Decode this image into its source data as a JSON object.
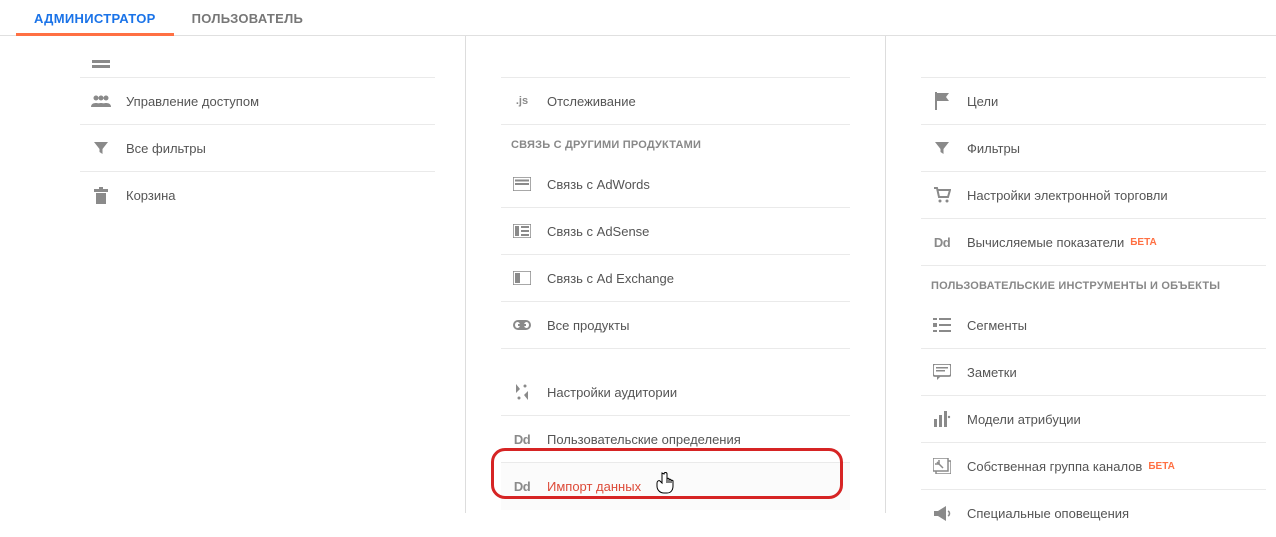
{
  "tabs": {
    "admin": "АДМИНИСТРАТОР",
    "user": "ПОЛЬЗОВАТЕЛЬ"
  },
  "col1": {
    "items": [
      {
        "label": "Управление доступом"
      },
      {
        "label": "Все фильтры"
      },
      {
        "label": "Корзина"
      }
    ]
  },
  "col2": {
    "tracking": {
      "label": "Отслеживание"
    },
    "header_products": "СВЯЗЬ С ДРУГИМИ ПРОДУКТАМИ",
    "products": [
      {
        "label": "Связь с AdWords"
      },
      {
        "label": "Связь с AdSense"
      },
      {
        "label": "Связь с Ad Exchange"
      },
      {
        "label": "Все продукты"
      }
    ],
    "audience": {
      "label": "Настройки аудитории"
    },
    "custom_def": {
      "label": "Пользовательские определения"
    },
    "import": {
      "label": "Импорт данных"
    }
  },
  "col3": {
    "goals": {
      "label": "Цели"
    },
    "filters": {
      "label": "Фильтры"
    },
    "ecom": {
      "label": "Настройки электронной торговли"
    },
    "calc": {
      "label": "Вычисляемые показатели",
      "badge": "БЕТА"
    },
    "header_tools": "ПОЛЬЗОВАТЕЛЬСКИЕ ИНСТРУМЕНТЫ И ОБЪЕКТЫ",
    "segments": {
      "label": "Сегменты"
    },
    "notes": {
      "label": "Заметки"
    },
    "attribution": {
      "label": "Модели атрибуции"
    },
    "channel_group": {
      "label": "Собственная группа каналов",
      "badge": "БЕТА"
    },
    "alerts": {
      "label": "Специальные оповещения"
    }
  }
}
